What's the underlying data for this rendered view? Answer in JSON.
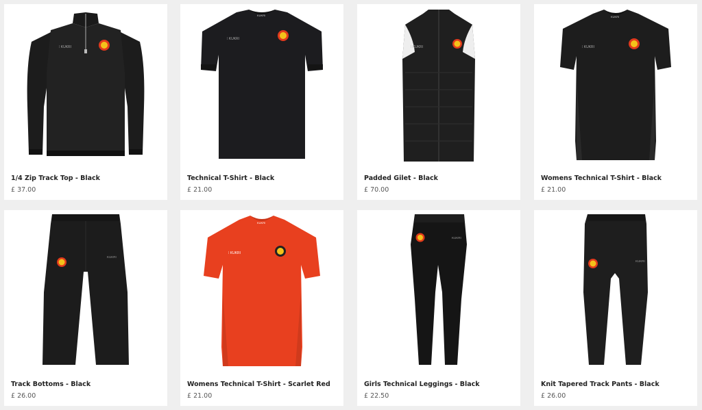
{
  "products": [
    {
      "name": "1/4 Zip Track Top - Black",
      "price": "£ 37.00",
      "icon": "quarter-zip-top-icon",
      "color": "#1c1c1c"
    },
    {
      "name": "Technical T-Shirt - Black",
      "price": "£ 21.00",
      "icon": "tshirt-icon",
      "color": "#1c1c1f"
    },
    {
      "name": "Padded Gilet - Black",
      "price": "£ 70.00",
      "icon": "gilet-icon",
      "color": "#1f1f1f"
    },
    {
      "name": "Womens Technical T-Shirt - Black",
      "price": "£ 21.00",
      "icon": "womens-tshirt-icon",
      "color": "#1d1d1d"
    },
    {
      "name": "Track Bottoms - Black",
      "price": "£ 26.00",
      "icon": "track-bottoms-icon",
      "color": "#1c1c1c"
    },
    {
      "name": "Womens Technical T-Shirt - Scarlet Red",
      "price": "£ 21.00",
      "icon": "womens-tshirt-red-icon",
      "color": "#e8401f"
    },
    {
      "name": "Girls Technical Leggings - Black",
      "price": "£ 22.50",
      "icon": "leggings-icon",
      "color": "#151515"
    },
    {
      "name": "Knit Tapered Track Pants - Black",
      "price": "£ 26.00",
      "icon": "tapered-pants-icon",
      "color": "#1e1e1e"
    }
  ],
  "brand_label": "KUKRI",
  "crest_colors": {
    "outer": "#e23a1c",
    "inner": "#f4c21a"
  }
}
